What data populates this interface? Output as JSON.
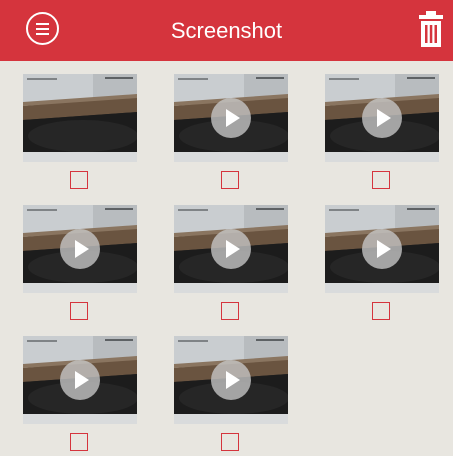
{
  "header": {
    "title": "Screenshot",
    "menu_icon": "menu-circle-icon",
    "trash_icon": "trash-icon",
    "accent": "#d5343d"
  },
  "media": [
    {
      "type": "photo",
      "selected": false
    },
    {
      "type": "video",
      "selected": false
    },
    {
      "type": "video",
      "selected": false
    },
    {
      "type": "video",
      "selected": false
    },
    {
      "type": "video",
      "selected": false
    },
    {
      "type": "video",
      "selected": false
    },
    {
      "type": "video",
      "selected": false
    },
    {
      "type": "video",
      "selected": false
    }
  ]
}
